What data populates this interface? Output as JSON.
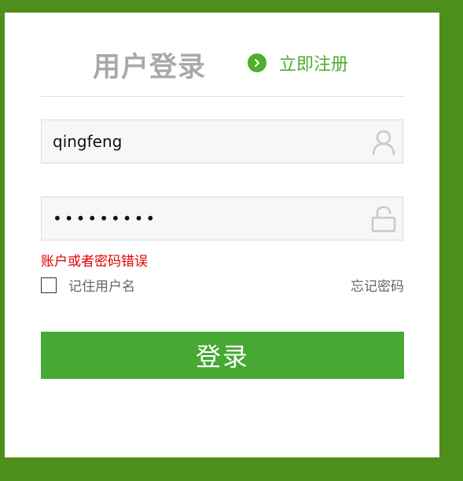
{
  "header": {
    "title": "用户登录",
    "register_label": "立即注册",
    "register_icon": "chevron-right-circle-icon"
  },
  "form": {
    "username": {
      "value": "qingfeng",
      "icon": "user-icon"
    },
    "password": {
      "value": "•••••••••",
      "icon": "unlock-icon"
    },
    "error_message": "账户或者密码错误",
    "remember": {
      "label": "记住用户名",
      "checked": false
    },
    "forgot_label": "忘记密码",
    "submit_label": "登录"
  },
  "colors": {
    "background": "#4e8e1a",
    "accent": "#4fae2c",
    "button": "#45a934",
    "error": "#e00000",
    "title": "#a9a9a9"
  }
}
